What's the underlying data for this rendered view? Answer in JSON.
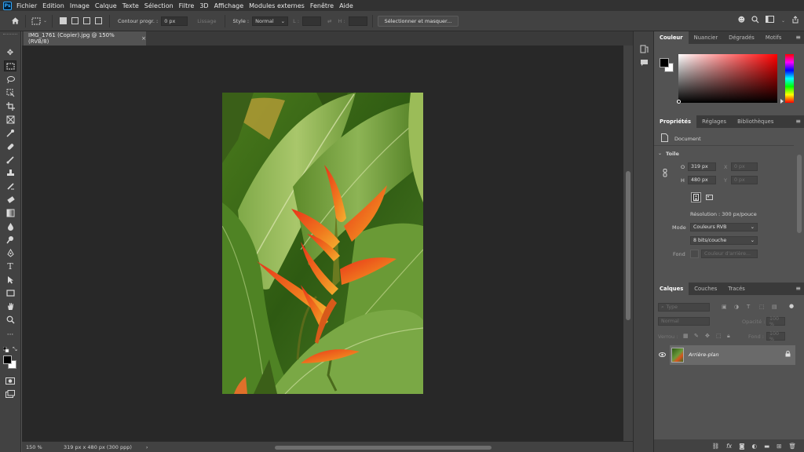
{
  "app": {
    "logo": "Ps"
  },
  "menu": [
    "Fichier",
    "Edition",
    "Image",
    "Calque",
    "Texte",
    "Sélection",
    "Filtre",
    "3D",
    "Affichage",
    "Modules externes",
    "Fenêtre",
    "Aide"
  ],
  "options_bar": {
    "feather_label": "Contour progr. :",
    "feather_value": "0 px",
    "smoothing_label": "Lissage",
    "style_label": "Style :",
    "style_value": "Normal",
    "width_label": "L :",
    "height_label": "H :",
    "select_mask_button": "Sélectionner et masquer..."
  },
  "document_tab": {
    "title": "IMG_1761 (Copier).jpg @ 150% (RVB/8)",
    "close": "×"
  },
  "status_bar": {
    "zoom": "150 %",
    "info": "319 px x 480 px (300 ppp)",
    "arrow": "›"
  },
  "color_panel": {
    "tabs": [
      "Couleur",
      "Nuancier",
      "Dégradés",
      "Motifs"
    ]
  },
  "properties_panel": {
    "tabs": [
      "Propriétés",
      "Réglages",
      "Bibliothèques"
    ],
    "document_label": "Document",
    "section_title": "Toile",
    "width_label": "O",
    "width_value": "319 px",
    "height_label": "H",
    "height_value": "480 px",
    "x_label": "X",
    "x_value": "0 px",
    "y_label": "Y",
    "y_value": "0 px",
    "resolution": "Résolution : 300 px/pouce",
    "mode_label": "Mode",
    "mode_value": "Couleurs RVB",
    "depth_value": "8 bits/couche",
    "background_label": "Fond",
    "background_value": "Couleur d'arrière..."
  },
  "layers_panel": {
    "tabs": [
      "Calques",
      "Couches",
      "Tracés"
    ],
    "filter_placeholder": "Type",
    "blend_mode": "Normal",
    "opacity_label": "Opacité :",
    "opacity_value": "100 %",
    "lock_label": "Verrou :",
    "fill_label": "Fond :",
    "fill_value": "100 %",
    "layers": [
      {
        "name": "Arrière-plan",
        "visible": true,
        "locked": true
      }
    ],
    "footer_icons": [
      "link-icon",
      "fx-icon",
      "mask-icon",
      "adjustment-icon",
      "group-icon",
      "new-layer-icon",
      "trash-icon"
    ]
  },
  "tools": [
    "move",
    "marquee",
    "lasso",
    "object-select",
    "crop",
    "frame",
    "eyedropper",
    "healing",
    "brush",
    "stamp",
    "history-brush",
    "eraser",
    "gradient",
    "blur",
    "dodge",
    "pen",
    "type",
    "path-select",
    "rectangle",
    "hand",
    "zoom",
    "more"
  ],
  "colors": {
    "foreground": "#000000",
    "background": "#ffffff",
    "accent": "#31a8ff"
  }
}
